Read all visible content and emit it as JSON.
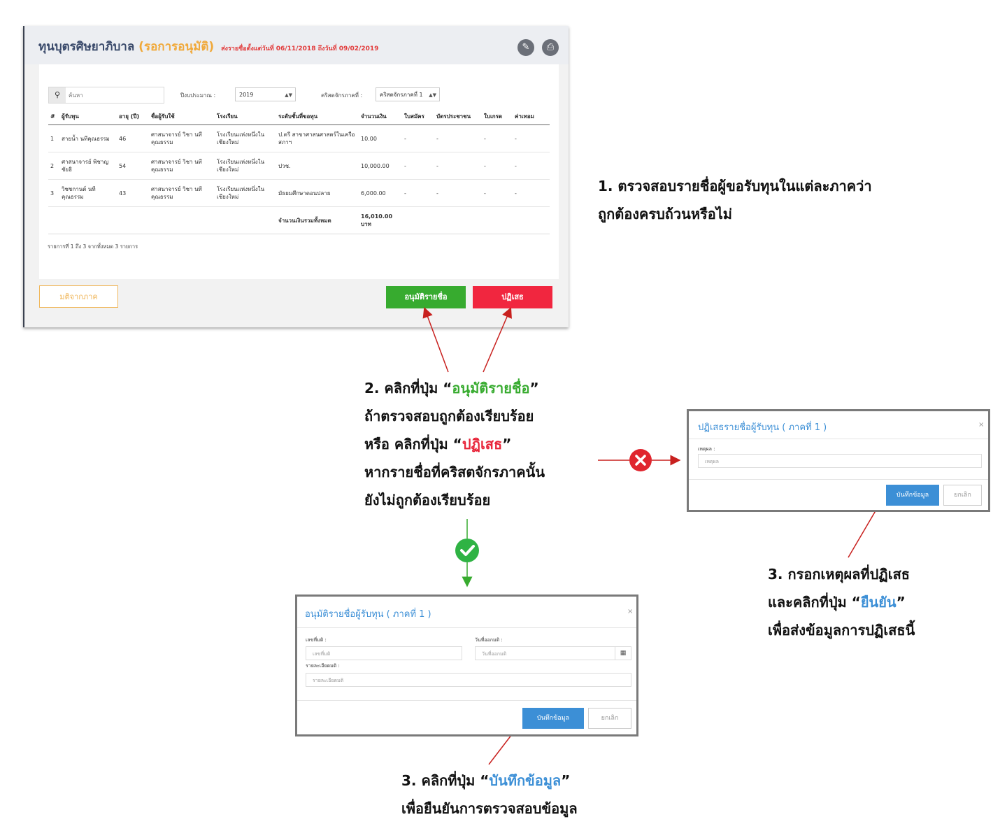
{
  "panel": {
    "title": "ทุนบุตรศิษยาภิบาล",
    "status_open": " (",
    "status": "รอการอนุมัติ",
    "status_close": ")",
    "date_range": "ส่งรายชื่อตั้งแต่วันที่ 06/11/2018 ถึงวันที่ 09/02/2019",
    "edit_icon": "external-link-icon",
    "print_icon": "print-icon"
  },
  "filters": {
    "search_placeholder": "ค้นหา",
    "year_label": "ปีงบประมาณ :",
    "year_value": "2019",
    "region_label": "คริสตจักรภาคที่ :",
    "region_value": "คริสตจักรภาคที่ 1"
  },
  "table": {
    "headers": [
      "#",
      "ผู้รับทุน",
      "อายุ (ปี)",
      "ชื่อผู้รับใช้",
      "โรงเรียน",
      "ระดับชั้นที่ขอทุน",
      "จำนวนเงิน",
      "ใบสมัคร",
      "บัตรประชาชน",
      "ใบเกรด",
      "ค่าเทอม"
    ],
    "rows": [
      [
        "1",
        "สายน้ำ นทีคุณธรรม",
        "46",
        "ศาสนาจารย์ วิชา นทีคุณธรรม",
        "โรงเรียนแห่งหนึ่งในเชียงใหม่",
        "ป.ตรี สาขาศาสนศาสตร์ในเครือสภาฯ",
        "10.00",
        "-",
        "-",
        "-",
        "-"
      ],
      [
        "2",
        "ศาสนาจารย์ พิชาญ ชัยธิ",
        "54",
        "ศาสนาจารย์ วิชา นทีคุณธรรม",
        "โรงเรียนแห่งหนึ่งในเชียงใหม่",
        "ปวช.",
        "10,000.00",
        "-",
        "-",
        "-",
        "-"
      ],
      [
        "3",
        "วิชชกานต์ นทีคุณธรรม",
        "43",
        "ศาสนาจารย์ วิชา นทีคุณธรรม",
        "โรงเรียนแห่งหนึ่งในเชียงใหม่",
        "มัธยมศึกษาตอนปลาย",
        "6,000.00",
        "-",
        "-",
        "-",
        "-"
      ]
    ],
    "total_label": "จำนวนเงินรวมทั้งหมด",
    "total_value": "16,010.00 บาท"
  },
  "footer_info": "รายการที่ 1 ถึง 3 จากทั้งหมด 3 รายการ",
  "buttons": {
    "back": "มติจากภาค",
    "approve": "อนุมัติรายชื่อ",
    "reject": "ปฏิเสธ"
  },
  "notes": {
    "n1_line1": "1. ตรวจสอบรายชื่อผู้ขอรับทุนในแต่ละภาคว่า",
    "n1_line2": "ถูกต้องครบถ้วนหรือไม่",
    "n2_line1_a": "2. คลิกที่ปุ่ม “",
    "n2_line1_b": "อนุมัติรายชื่อ",
    "n2_line1_c": "”",
    "n2_line2": "ถ้าตรวจสอบถูกต้องเรียบร้อย",
    "n2_line3_a": "หรือ คลิกที่ปุ่ม “",
    "n2_line3_b": "ปฏิเสธ",
    "n2_line3_c": "”",
    "n2_line4": "หากรายชื่อที่คริสตจักรภาคนั้น",
    "n2_line5": "ยังไม่ถูกต้องเรียบร้อย",
    "n3r_line1": "3. กรอกเหตุผลที่ปฏิเสธ",
    "n3r_line2_a": "และคลิกที่ปุ่ม “",
    "n3r_line2_b": "ยืนยัน",
    "n3r_line2_c": "”",
    "n3r_line3": "เพื่อส่งข้อมูลการปฏิเสธนี้",
    "n3a_line1_a": "3. คลิกที่ปุ่ม “",
    "n3a_line1_b": "บันทึกข้อมูล",
    "n3a_line1_c": "”",
    "n3a_line2": "เพื่อยืนยันการตรวจสอบข้อมูล"
  },
  "reject_modal": {
    "title": "ปฏิเสธรายชื่อผู้รับทุน ( ภาคที่ 1 )",
    "close": "×",
    "reason_label": "เหตุผล :",
    "reason_placeholder": "เหตุผล",
    "save": "บันทึกข้อมูล",
    "cancel": "ยกเลิก"
  },
  "approve_modal": {
    "title": "อนุมัติรายชื่อผู้รับทุน ( ภาคที่ 1 )",
    "close": "×",
    "resolution_label": "เลขที่มติ :",
    "resolution_placeholder": "เลขที่มติ",
    "date_label": "วันที่ออกมติ :",
    "date_placeholder": "วันที่ออกมติ",
    "detail_label": "รายละเอียดมติ :",
    "detail_placeholder": "รายละเอียดมติ",
    "save": "บันทึกข้อมูล",
    "cancel": "ยกเลิก"
  },
  "colors": {
    "approve": "#37ab2f",
    "reject": "#f1263f",
    "accent_blue": "#3c8fd6",
    "status_orange": "#f0a93b"
  }
}
